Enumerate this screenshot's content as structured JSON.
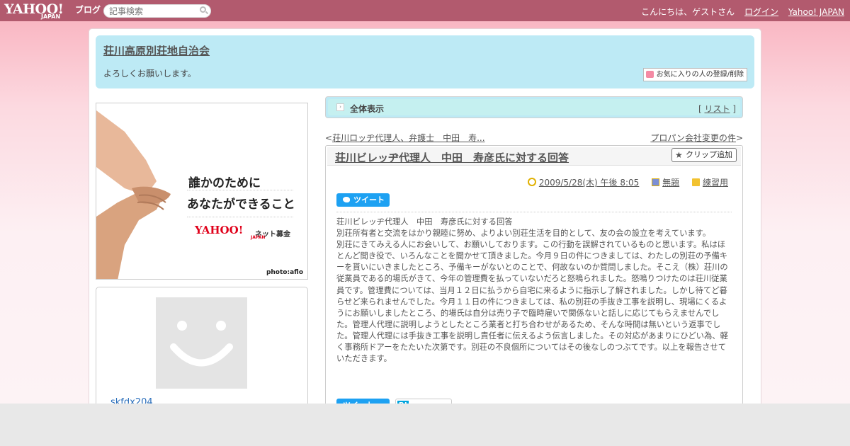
{
  "topbar": {
    "logo_text": "YAHOO!",
    "logo_sub": "JAPAN",
    "logo_blog": "ブログ",
    "search_placeholder": "記事検索",
    "greeting": "こんにちは、ゲストさん",
    "login": "ログイン",
    "yahoo_japan": "Yahoo! JAPAN"
  },
  "header": {
    "title": "荘川高原別荘地自治会",
    "description": "よろしくお願いします。",
    "fav_button": "お気に入りの人の登録/削除"
  },
  "banner": {
    "line1": "誰かのために",
    "line2": "あなたができること",
    "logo": "YAHOO!",
    "logo_sub": "JAPAN",
    "donation": "ネット募金",
    "credit": "photo:aflo"
  },
  "profile": {
    "name": "skfdx204"
  },
  "main": {
    "all_label": "全体表示",
    "list_prefix": "[ ",
    "list_link": "リスト",
    "list_suffix": " ]",
    "prev_prefix": "<",
    "prev_link": "荘川ロッヂ代理人、弁護士　中田　寿...",
    "next_link": "プロパン会社変更の件",
    "next_suffix": ">"
  },
  "article": {
    "title": "荘川ビレッヂ代理人　中田　寿彦氏に対する回答",
    "clip_button": "クリップ追加",
    "date": "2009/5/28(木) 午後 8:05",
    "theme": "無題",
    "category": "練習用",
    "tweet": "ツイート",
    "body": [
      "荘川ビレッヂ代理人　中田　寿彦氏に対する回答",
      "別荘所有者と交流をはかり親睦に努め、よりよい別荘生活を目的として、友の会の設立を考えています。",
      "別荘にきてみえる人にお会いして、お願いしております。この行動を誤解されているものと思います。私はほとんど聞き役で、いろんなことを聞かせて頂きました。今月９日の件につきましては、わたしの別荘の予備キーを貰いにいきましたところ、予備キーがないとのことで、何故ないのか質問しました。そこえ（株）荘川の従業員である的場氏がきて、今年の管理費を払っていないだろと怒鳴られました。怒鳴りつけたのは荘川従業員です。管理費については、当月１２日に払うから自宅に来るように指示し了解されました。しかし待てど暮らせど来られませんでした。今月１１日の件につきましては、私の別荘の手抜き工事を説明し、現場にくるようにお願いしましたところ、的場氏は自分は売り子で臨時雇いで関係ないと話しに応じてもらえませんでした。管理人代理に説明しようとしたところ業者と打ち合わせがあるため、そんな時間は無いという返事でした。管理人代理には手抜き工事を説明し責任者に伝えるよう伝言しました。その対応があまりにひどい為、軽く事務所ドアーをたたいた次第です。別荘の不良個所についてはその後なしのつぶてです。以上を報告させていただきます。"
    ]
  },
  "colors": {
    "topbar": "#b25a6e",
    "header_bg": "#bdeaf5",
    "link_blue": "#2a6ebb",
    "tweet_blue": "#1da1f2"
  }
}
